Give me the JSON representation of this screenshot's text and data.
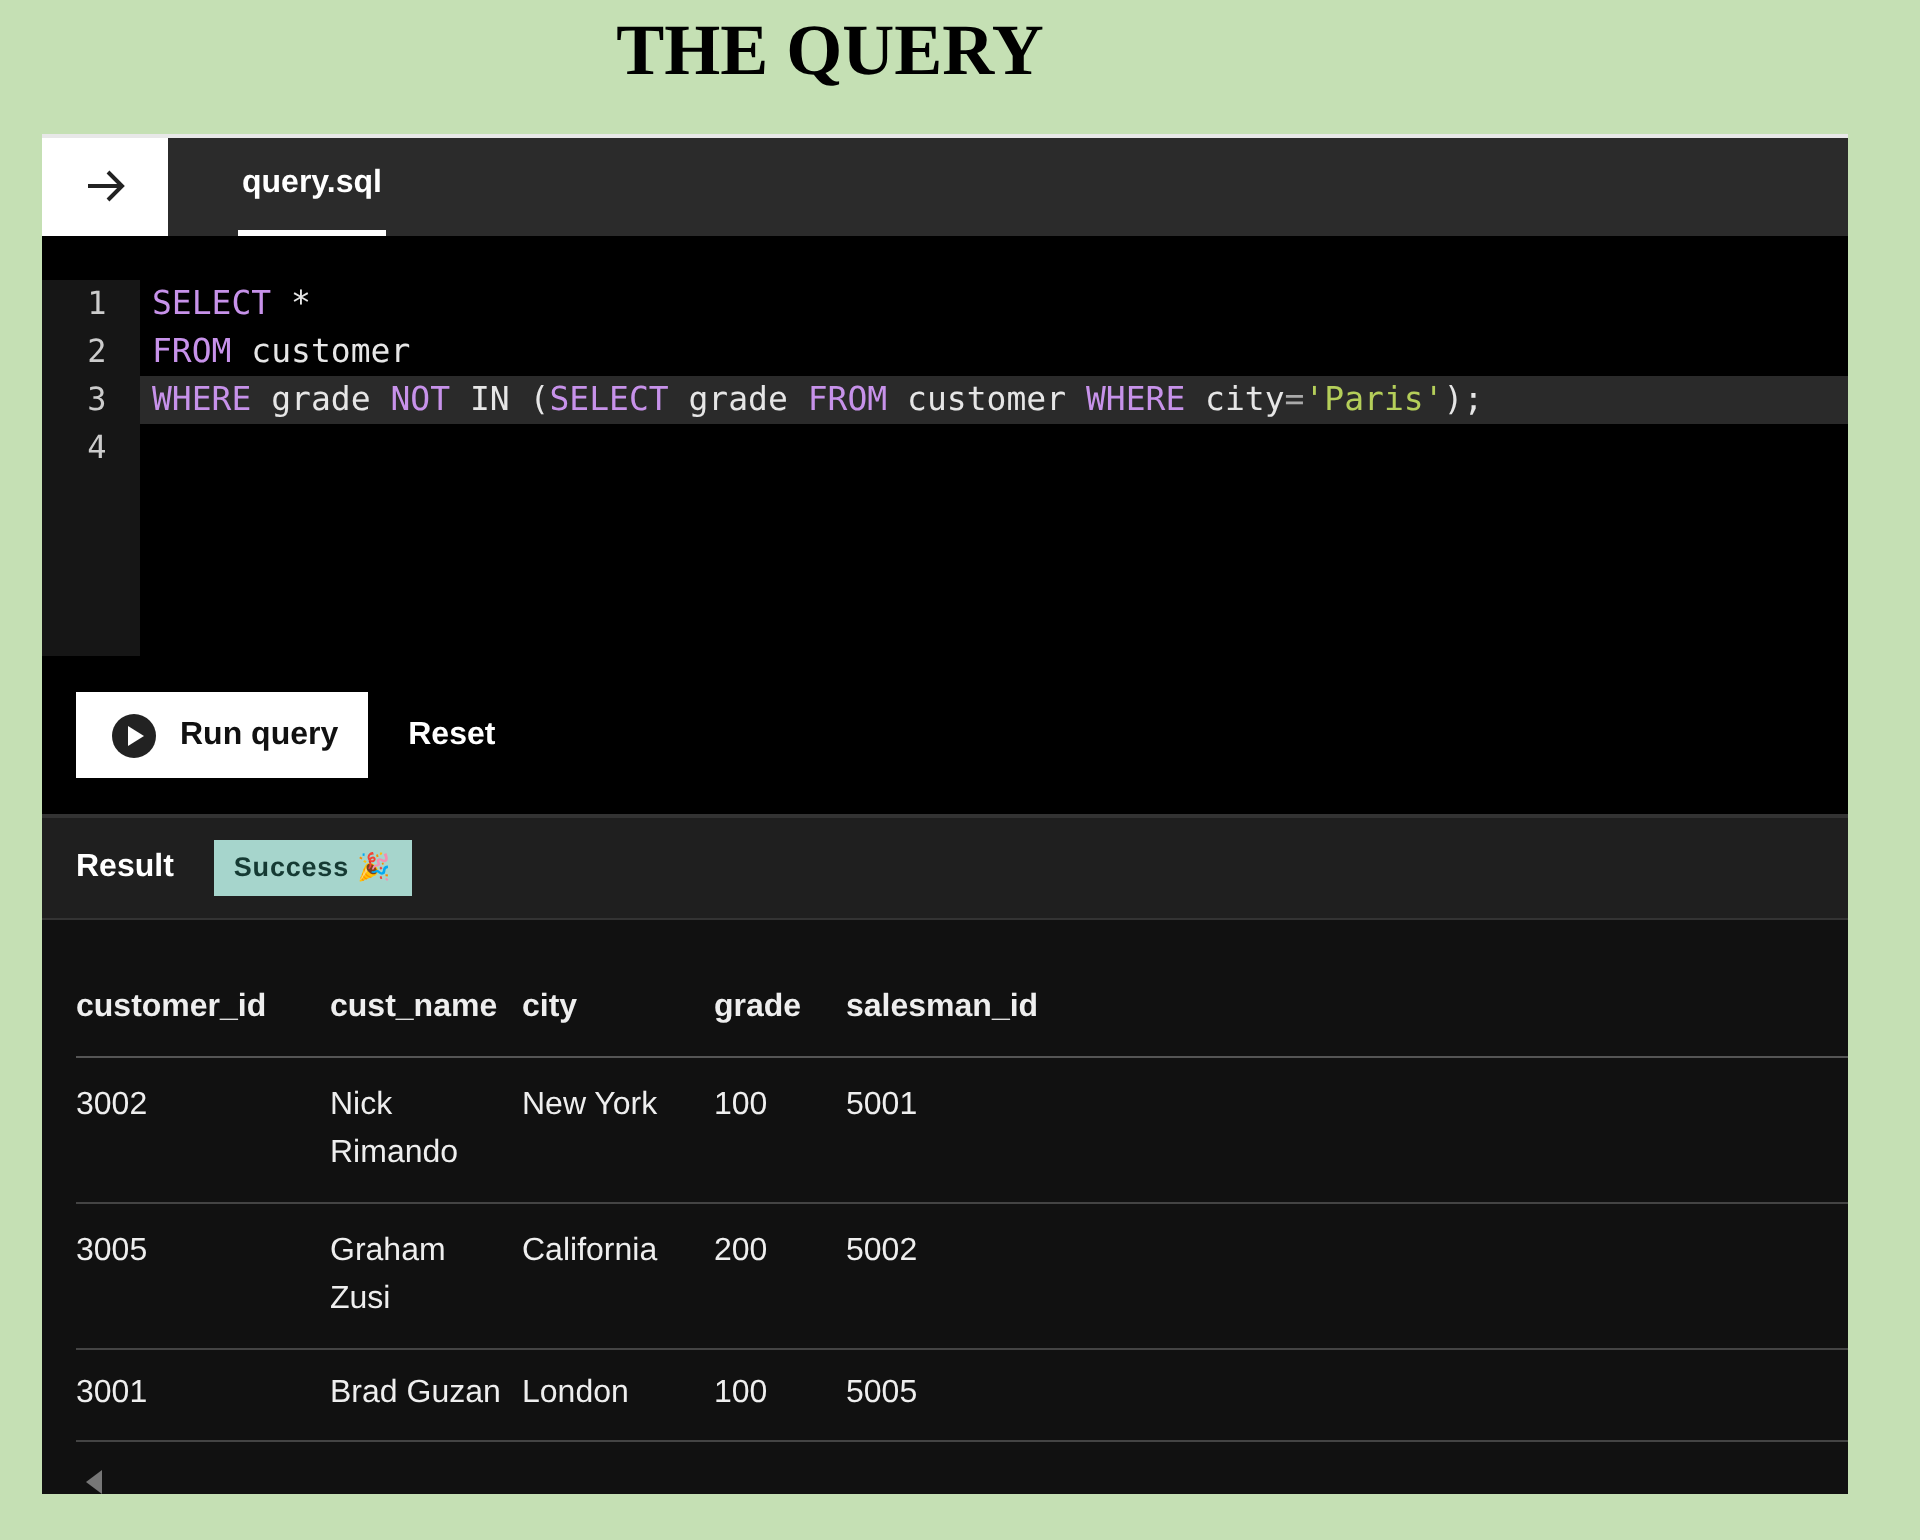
{
  "heading": "THE QUERY",
  "tab": {
    "label": "query.sql",
    "selected": true
  },
  "editor": {
    "lines": [
      {
        "number": "1",
        "active": false,
        "tokens": [
          {
            "kind": "keyword",
            "text": "SELECT"
          },
          {
            "kind": "plain",
            "text": " *"
          }
        ]
      },
      {
        "number": "2",
        "active": false,
        "tokens": [
          {
            "kind": "keyword",
            "text": "FROM"
          },
          {
            "kind": "plain",
            "text": " customer"
          }
        ]
      },
      {
        "number": "3",
        "active": true,
        "tokens": [
          {
            "kind": "keyword",
            "text": "WHERE"
          },
          {
            "kind": "plain",
            "text": " grade "
          },
          {
            "kind": "keyword",
            "text": "NOT"
          },
          {
            "kind": "plain",
            "text": " IN ("
          },
          {
            "kind": "keyword",
            "text": "SELECT"
          },
          {
            "kind": "plain",
            "text": " grade "
          },
          {
            "kind": "keyword",
            "text": "FROM"
          },
          {
            "kind": "plain",
            "text": " customer "
          },
          {
            "kind": "keyword",
            "text": "WHERE"
          },
          {
            "kind": "plain",
            "text": " city"
          },
          {
            "kind": "operator",
            "text": "="
          },
          {
            "kind": "string",
            "text": "'Paris'"
          },
          {
            "kind": "plain",
            "text": ");"
          }
        ]
      },
      {
        "number": "4",
        "active": false
      }
    ]
  },
  "buttons": {
    "run": "Run query",
    "reset": "Reset"
  },
  "result": {
    "label": "Result",
    "status": "Success 🎉"
  },
  "table": {
    "columns": [
      "customer_id",
      "cust_name",
      "city",
      "grade",
      "salesman_id"
    ],
    "rows": [
      [
        "3002",
        "Nick Rimando",
        "New York",
        "100",
        "5001"
      ],
      [
        "3005",
        "Graham Zusi",
        "California",
        "200",
        "5002"
      ],
      [
        "3001",
        "Brad Guzan",
        "London",
        "100",
        "5005"
      ]
    ]
  }
}
